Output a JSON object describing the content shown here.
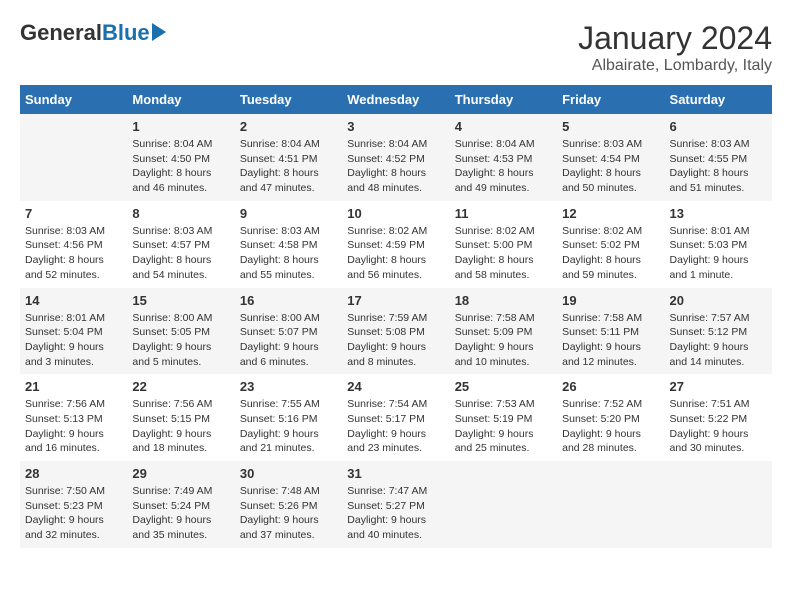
{
  "logo": {
    "general": "General",
    "blue": "Blue"
  },
  "title": "January 2024",
  "subtitle": "Albairate, Lombardy, Italy",
  "headers": [
    "Sunday",
    "Monday",
    "Tuesday",
    "Wednesday",
    "Thursday",
    "Friday",
    "Saturday"
  ],
  "weeks": [
    [
      {
        "day": "",
        "sunrise": "",
        "sunset": "",
        "daylight": ""
      },
      {
        "day": "1",
        "sunrise": "Sunrise: 8:04 AM",
        "sunset": "Sunset: 4:50 PM",
        "daylight": "Daylight: 8 hours and 46 minutes."
      },
      {
        "day": "2",
        "sunrise": "Sunrise: 8:04 AM",
        "sunset": "Sunset: 4:51 PM",
        "daylight": "Daylight: 8 hours and 47 minutes."
      },
      {
        "day": "3",
        "sunrise": "Sunrise: 8:04 AM",
        "sunset": "Sunset: 4:52 PM",
        "daylight": "Daylight: 8 hours and 48 minutes."
      },
      {
        "day": "4",
        "sunrise": "Sunrise: 8:04 AM",
        "sunset": "Sunset: 4:53 PM",
        "daylight": "Daylight: 8 hours and 49 minutes."
      },
      {
        "day": "5",
        "sunrise": "Sunrise: 8:03 AM",
        "sunset": "Sunset: 4:54 PM",
        "daylight": "Daylight: 8 hours and 50 minutes."
      },
      {
        "day": "6",
        "sunrise": "Sunrise: 8:03 AM",
        "sunset": "Sunset: 4:55 PM",
        "daylight": "Daylight: 8 hours and 51 minutes."
      }
    ],
    [
      {
        "day": "7",
        "sunrise": "Sunrise: 8:03 AM",
        "sunset": "Sunset: 4:56 PM",
        "daylight": "Daylight: 8 hours and 52 minutes."
      },
      {
        "day": "8",
        "sunrise": "Sunrise: 8:03 AM",
        "sunset": "Sunset: 4:57 PM",
        "daylight": "Daylight: 8 hours and 54 minutes."
      },
      {
        "day": "9",
        "sunrise": "Sunrise: 8:03 AM",
        "sunset": "Sunset: 4:58 PM",
        "daylight": "Daylight: 8 hours and 55 minutes."
      },
      {
        "day": "10",
        "sunrise": "Sunrise: 8:02 AM",
        "sunset": "Sunset: 4:59 PM",
        "daylight": "Daylight: 8 hours and 56 minutes."
      },
      {
        "day": "11",
        "sunrise": "Sunrise: 8:02 AM",
        "sunset": "Sunset: 5:00 PM",
        "daylight": "Daylight: 8 hours and 58 minutes."
      },
      {
        "day": "12",
        "sunrise": "Sunrise: 8:02 AM",
        "sunset": "Sunset: 5:02 PM",
        "daylight": "Daylight: 8 hours and 59 minutes."
      },
      {
        "day": "13",
        "sunrise": "Sunrise: 8:01 AM",
        "sunset": "Sunset: 5:03 PM",
        "daylight": "Daylight: 9 hours and 1 minute."
      }
    ],
    [
      {
        "day": "14",
        "sunrise": "Sunrise: 8:01 AM",
        "sunset": "Sunset: 5:04 PM",
        "daylight": "Daylight: 9 hours and 3 minutes."
      },
      {
        "day": "15",
        "sunrise": "Sunrise: 8:00 AM",
        "sunset": "Sunset: 5:05 PM",
        "daylight": "Daylight: 9 hours and 5 minutes."
      },
      {
        "day": "16",
        "sunrise": "Sunrise: 8:00 AM",
        "sunset": "Sunset: 5:07 PM",
        "daylight": "Daylight: 9 hours and 6 minutes."
      },
      {
        "day": "17",
        "sunrise": "Sunrise: 7:59 AM",
        "sunset": "Sunset: 5:08 PM",
        "daylight": "Daylight: 9 hours and 8 minutes."
      },
      {
        "day": "18",
        "sunrise": "Sunrise: 7:58 AM",
        "sunset": "Sunset: 5:09 PM",
        "daylight": "Daylight: 9 hours and 10 minutes."
      },
      {
        "day": "19",
        "sunrise": "Sunrise: 7:58 AM",
        "sunset": "Sunset: 5:11 PM",
        "daylight": "Daylight: 9 hours and 12 minutes."
      },
      {
        "day": "20",
        "sunrise": "Sunrise: 7:57 AM",
        "sunset": "Sunset: 5:12 PM",
        "daylight": "Daylight: 9 hours and 14 minutes."
      }
    ],
    [
      {
        "day": "21",
        "sunrise": "Sunrise: 7:56 AM",
        "sunset": "Sunset: 5:13 PM",
        "daylight": "Daylight: 9 hours and 16 minutes."
      },
      {
        "day": "22",
        "sunrise": "Sunrise: 7:56 AM",
        "sunset": "Sunset: 5:15 PM",
        "daylight": "Daylight: 9 hours and 18 minutes."
      },
      {
        "day": "23",
        "sunrise": "Sunrise: 7:55 AM",
        "sunset": "Sunset: 5:16 PM",
        "daylight": "Daylight: 9 hours and 21 minutes."
      },
      {
        "day": "24",
        "sunrise": "Sunrise: 7:54 AM",
        "sunset": "Sunset: 5:17 PM",
        "daylight": "Daylight: 9 hours and 23 minutes."
      },
      {
        "day": "25",
        "sunrise": "Sunrise: 7:53 AM",
        "sunset": "Sunset: 5:19 PM",
        "daylight": "Daylight: 9 hours and 25 minutes."
      },
      {
        "day": "26",
        "sunrise": "Sunrise: 7:52 AM",
        "sunset": "Sunset: 5:20 PM",
        "daylight": "Daylight: 9 hours and 28 minutes."
      },
      {
        "day": "27",
        "sunrise": "Sunrise: 7:51 AM",
        "sunset": "Sunset: 5:22 PM",
        "daylight": "Daylight: 9 hours and 30 minutes."
      }
    ],
    [
      {
        "day": "28",
        "sunrise": "Sunrise: 7:50 AM",
        "sunset": "Sunset: 5:23 PM",
        "daylight": "Daylight: 9 hours and 32 minutes."
      },
      {
        "day": "29",
        "sunrise": "Sunrise: 7:49 AM",
        "sunset": "Sunset: 5:24 PM",
        "daylight": "Daylight: 9 hours and 35 minutes."
      },
      {
        "day": "30",
        "sunrise": "Sunrise: 7:48 AM",
        "sunset": "Sunset: 5:26 PM",
        "daylight": "Daylight: 9 hours and 37 minutes."
      },
      {
        "day": "31",
        "sunrise": "Sunrise: 7:47 AM",
        "sunset": "Sunset: 5:27 PM",
        "daylight": "Daylight: 9 hours and 40 minutes."
      },
      {
        "day": "",
        "sunrise": "",
        "sunset": "",
        "daylight": ""
      },
      {
        "day": "",
        "sunrise": "",
        "sunset": "",
        "daylight": ""
      },
      {
        "day": "",
        "sunrise": "",
        "sunset": "",
        "daylight": ""
      }
    ]
  ]
}
